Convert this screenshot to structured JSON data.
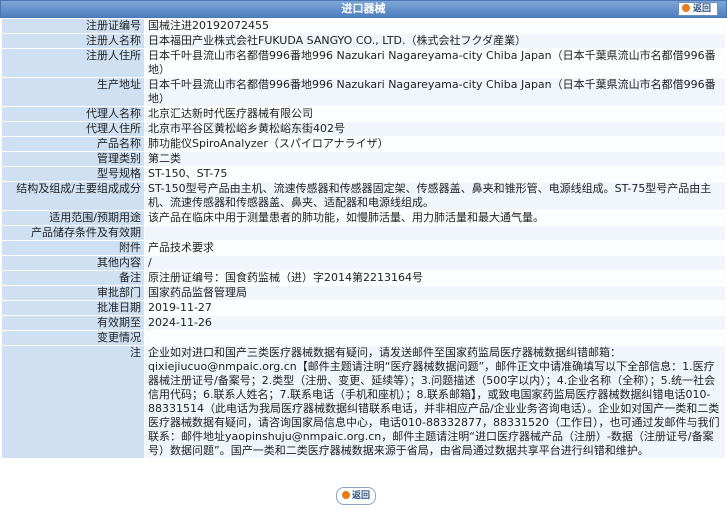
{
  "header": {
    "title": "进口器械",
    "back_label": "返回"
  },
  "rows": [
    {
      "label": "注册证编号",
      "value": "国械注进20192072455"
    },
    {
      "label": "注册人名称",
      "value": "日本福田产业株式会社FUKUDA SANGYO CO., LTD.（株式会社フクダ産業）"
    },
    {
      "label": "注册人住所",
      "value": "日本千叶县流山市名都借996番地996 Nazukari Nagareyama-city Chiba Japan（日本千葉県流山市名都借996番地）"
    },
    {
      "label": "生产地址",
      "value": "日本千叶县流山市名都借996番地996 Nazukari Nagareyama-city Chiba Japan（日本千葉県流山市名都借996番地）"
    },
    {
      "label": "代理人名称",
      "value": "北京汇达新时代医疗器械有限公司"
    },
    {
      "label": "代理人住所",
      "value": "北京市平谷区黄松峪乡黄松峪东街402号"
    },
    {
      "label": "产品名称",
      "value": "肺功能仪SpiroAnalyzer（スパイロアナライザ）"
    },
    {
      "label": "管理类别",
      "value": "第二类"
    },
    {
      "label": "型号规格",
      "value": "ST-150、ST-75"
    },
    {
      "label": "结构及组成/主要组成成分",
      "value": "ST-150型号产品由主机、流速传感器和传感器固定架、传感器盖、鼻夹和锥形管、电源线组成。ST-75型号产品由主机、流速传感器和传感器盖、鼻夹、适配器和电源线组成。"
    },
    {
      "label": "适用范围/预期用途",
      "value": "该产品在临床中用于测量患者的肺功能，如慢肺活量、用力肺活量和最大通气量。"
    },
    {
      "label": "产品储存条件及有效期",
      "value": ""
    },
    {
      "label": "附件",
      "value": "产品技术要求"
    },
    {
      "label": "其他内容",
      "value": "/"
    },
    {
      "label": "备注",
      "value": "原注册证编号：国食药监械（进）字2014第2213164号"
    },
    {
      "label": "审批部门",
      "value": "国家药品监督管理局"
    },
    {
      "label": "批准日期",
      "value": "2019-11-27"
    },
    {
      "label": "有效期至",
      "value": "2024-11-26"
    },
    {
      "label": "变更情况",
      "value": ""
    }
  ],
  "note": {
    "label": "注",
    "text": "企业如对进口和国产三类医疗器械数据有疑问，请发送邮件至国家药监局医疗器械数据纠错邮箱：qixiejiucuo@nmpaic.org.cn【邮件主题请注明“医疗器械数据问题”，邮件正文中请准确填写以下全部信息：1.医疗器械注册证号/备案号；2.类型（注册、变更、延续等）；3.问题描述（500字以内）；4.企业名称（全称）；5.统一社会信用代码；6.联系人姓名；7.联系电话（手机和座机）；8.联系邮箱】，或致电国家药监局医疗器械数据纠错电话010-88331514（此电话为我局医疗器械数据纠错联系电话，并非相应产品/企业业务咨询电话）。企业如对国产一类和二类医疗器械数据有疑问，请咨询国家局信息中心，电话010-88332877，88331520（工作日），也可通过发邮件与我们联系：邮件地址yaopinshuju@nmpaic.org.cn，邮件主题请注明“进口医疗器械产品（注册）-数据（注册证号/备案号）数据问题”。国产一类和二类医疗器械数据来源于省局，由省局通过数据共享平台进行纠错和维护。"
  },
  "footer": {
    "back_label": "返回"
  }
}
